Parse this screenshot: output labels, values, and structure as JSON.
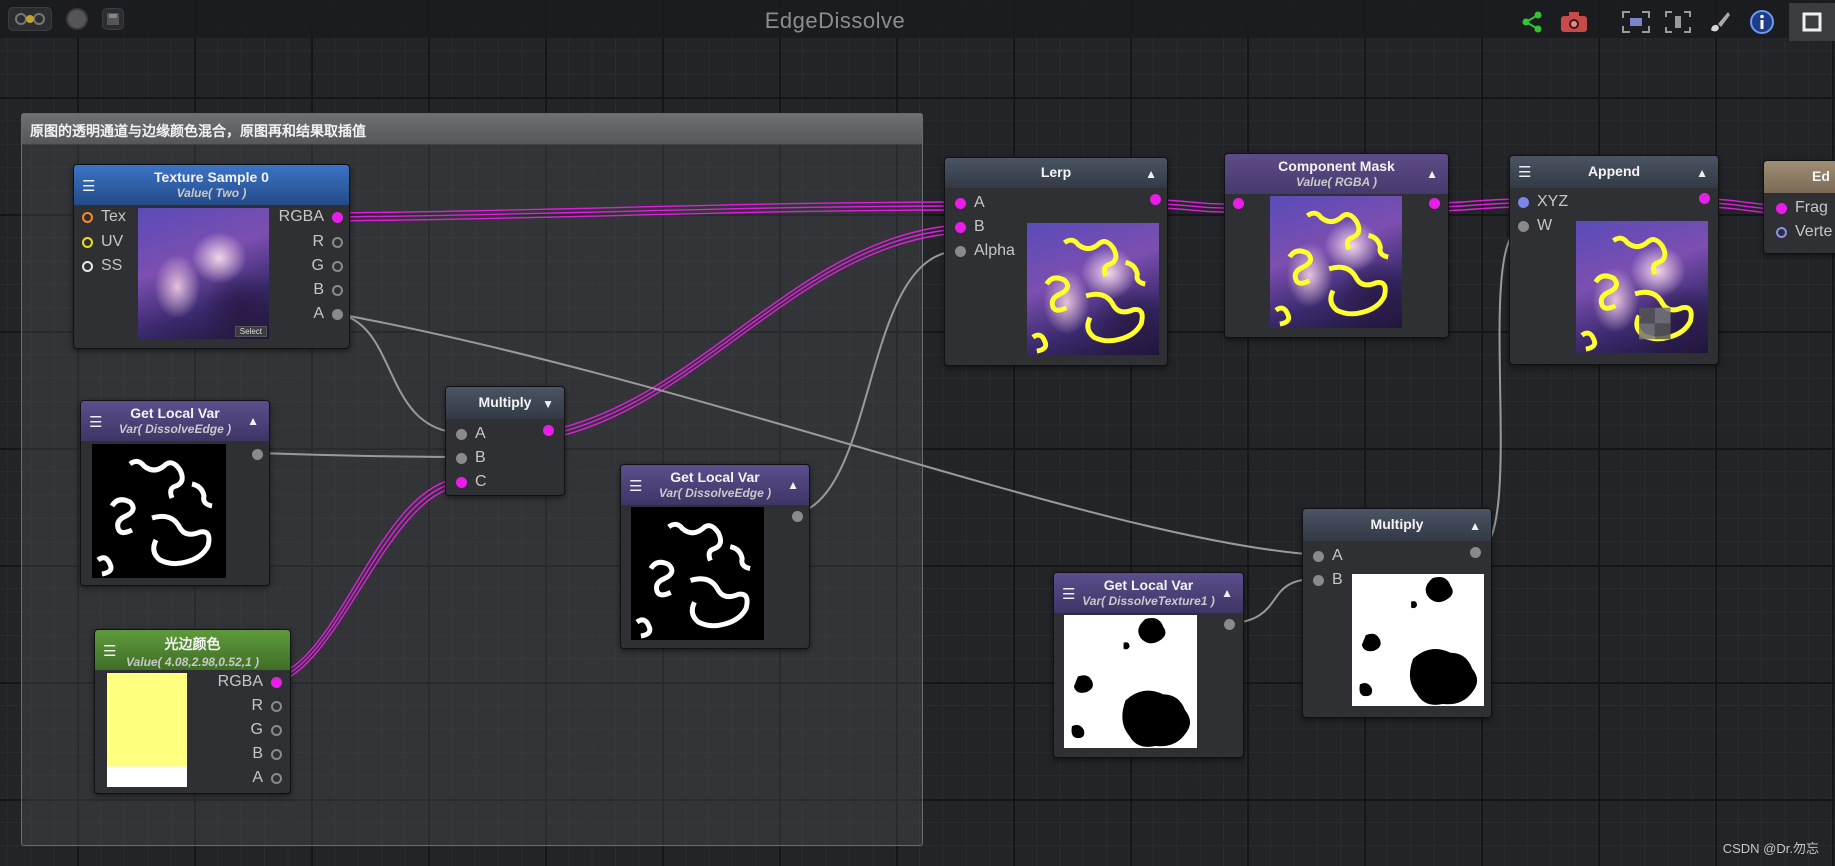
{
  "window": {
    "title": "EdgeDissolve"
  },
  "comment": {
    "text": "原图的透明通道与边缘颜色混合，原图再和结果取插值"
  },
  "nodes": {
    "texture_sample": {
      "title": "Texture Sample 0",
      "subtitle": "Value( Two )",
      "inputs": [
        "Tex",
        "UV",
        "SS"
      ],
      "outputs": [
        "RGBA",
        "R",
        "G",
        "B",
        "A"
      ],
      "select_label": "Select"
    },
    "local_var_1": {
      "title": "Get Local Var",
      "subtitle": "Var( DissolveEdge )"
    },
    "multiply_1": {
      "title": "Multiply",
      "inputs": [
        "A",
        "B",
        "C"
      ]
    },
    "color": {
      "title": "光边颜色",
      "subtitle": "Value( 4.08,2.98,0.52,1 )",
      "outputs": [
        "RGBA",
        "R",
        "G",
        "B",
        "A"
      ]
    },
    "local_var_2": {
      "title": "Get Local Var",
      "subtitle": "Var( DissolveEdge )"
    },
    "lerp": {
      "title": "Lerp",
      "inputs": [
        "A",
        "B",
        "Alpha"
      ]
    },
    "component_mask": {
      "title": "Component Mask",
      "subtitle": "Value( RGBA )"
    },
    "append": {
      "title": "Append",
      "inputs": [
        "XYZ",
        "W"
      ]
    },
    "output": {
      "title": "Ed",
      "inputs": [
        "Frag",
        "Verte"
      ]
    },
    "local_var_3": {
      "title": "Get Local Var",
      "subtitle": "Var( DissolveTexture1 )"
    },
    "multiply_2": {
      "title": "Multiply",
      "inputs": [
        "A",
        "B"
      ]
    }
  },
  "colors": {
    "wire_color": "#e01ee0",
    "edge_color": "#ffff80",
    "grey_wire": "#a0a0a0"
  },
  "icons": [
    "window-controls-icon",
    "record-icon",
    "save-icon",
    "share-icon",
    "camera-icon",
    "focus-icon",
    "fit-icon",
    "brush-icon",
    "info-icon",
    "maximize-icon"
  ],
  "watermark": "CSDN @Dr.勿忘"
}
